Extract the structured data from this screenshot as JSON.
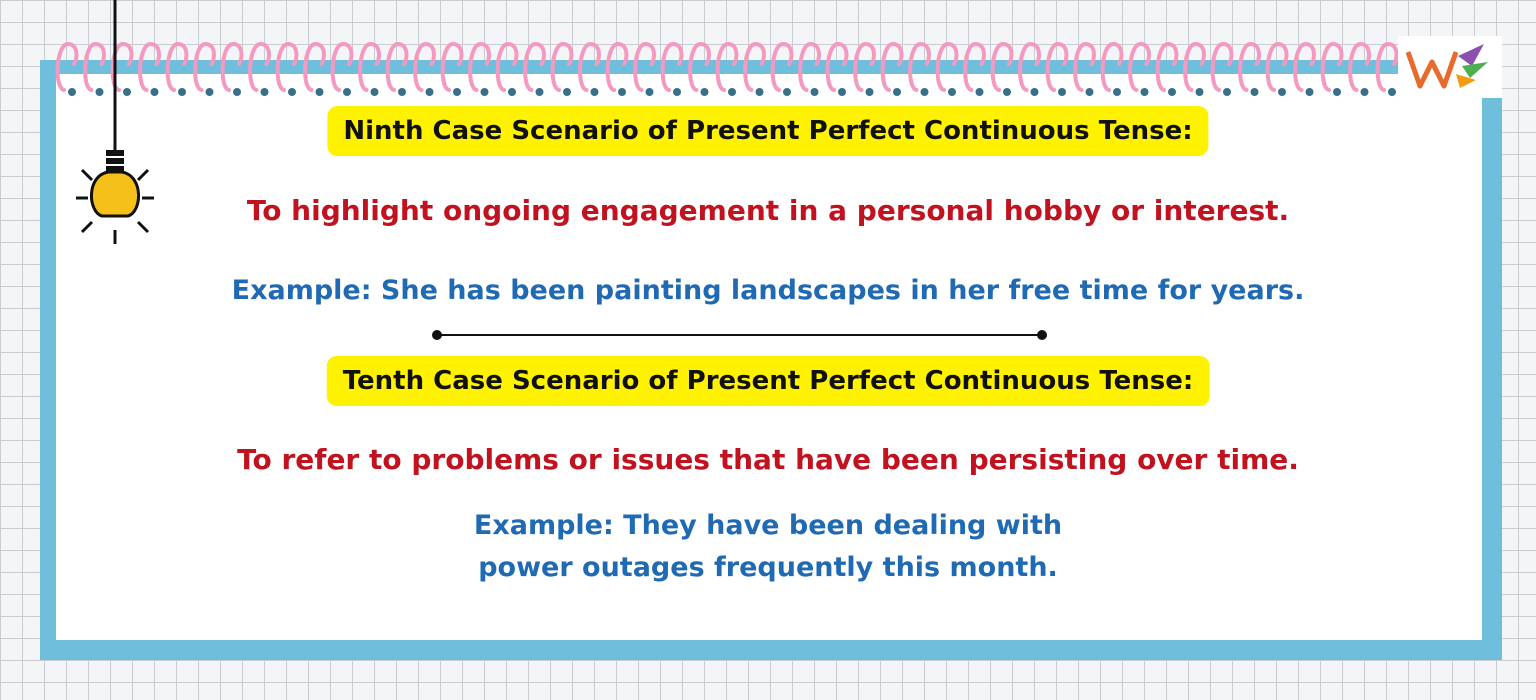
{
  "ninth": {
    "heading": "Ninth Case Scenario of Present Perfect Continuous Tense:",
    "usage": "To highlight ongoing engagement in a personal hobby or interest.",
    "example": "Example: She has been painting landscapes in her free time for years."
  },
  "tenth": {
    "heading": "Tenth Case Scenario of Present Perfect Continuous Tense:",
    "usage": "To refer to problems or issues that have been persisting over time.",
    "example_line1": "Example: They have been dealing with",
    "example_line2": "power outages frequently this month."
  },
  "icons": {
    "bulb": "lightbulb-icon",
    "logo": "brand-logo-icon"
  },
  "colors": {
    "heading_bg": "#fff200",
    "usage_text": "#c1121f",
    "example_text": "#1f6ab3",
    "board_border": "#6fbfdc",
    "rings": "#f49ac1"
  }
}
